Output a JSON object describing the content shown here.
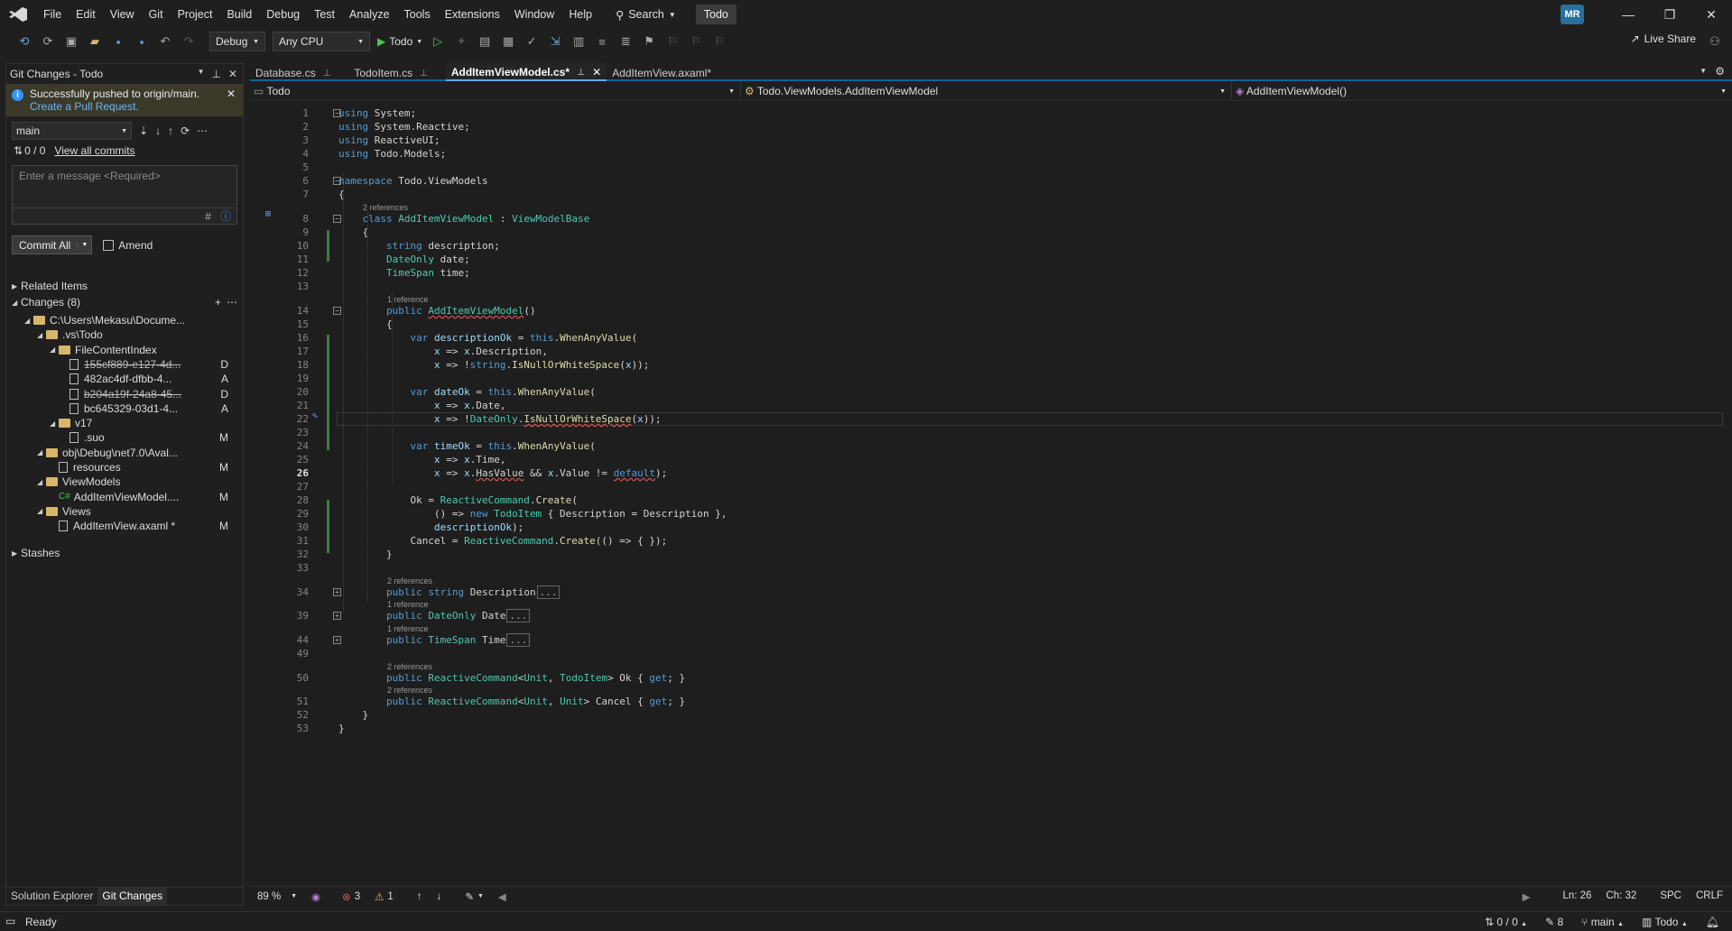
{
  "titlebar": {
    "menu": [
      "File",
      "Edit",
      "View",
      "Git",
      "Project",
      "Build",
      "Debug",
      "Test",
      "Analyze",
      "Tools",
      "Extensions",
      "Window",
      "Help"
    ],
    "search_label": "Search",
    "solution_name": "Todo",
    "user_initials": "MR"
  },
  "toolbar": {
    "config": "Debug",
    "platform": "Any CPU",
    "run_target": "Todo",
    "live_share": "Live Share"
  },
  "git_panel": {
    "title": "Git Changes - Todo",
    "notification": "Successfully pushed to origin/main.",
    "notification_link": "Create a Pull Request.",
    "branch": "main",
    "commit_counts": "0 / 0",
    "view_all_commits": "View all commits",
    "message_placeholder": "Enter a message <Required>",
    "commit_all": "Commit All",
    "amend": "Amend",
    "related_items": "Related Items",
    "changes": "Changes (8)",
    "stashes": "Stashes",
    "tree": [
      {
        "label": "C:\\Users\\Mekasu\\Docume...",
        "status": ""
      },
      {
        "label": ".vs\\Todo",
        "status": ""
      },
      {
        "label": "FileContentIndex",
        "status": ""
      },
      {
        "label": "155cf889-e127-4d...",
        "status": "D"
      },
      {
        "label": "482ac4df-dfbb-4...",
        "status": "A"
      },
      {
        "label": "b204a19f-24a8-45...",
        "status": "D"
      },
      {
        "label": "bc645329-03d1-4...",
        "status": "A"
      },
      {
        "label": "v17",
        "status": ""
      },
      {
        "label": ".suo",
        "status": "M"
      },
      {
        "label": "obj\\Debug\\net7.0\\Aval...",
        "status": ""
      },
      {
        "label": "resources",
        "status": "M"
      },
      {
        "label": "ViewModels",
        "status": ""
      },
      {
        "label": "AddItemViewModel....",
        "status": "M"
      },
      {
        "label": "Views",
        "status": ""
      },
      {
        "label": "AddItemView.axaml *",
        "status": "M"
      }
    ],
    "bottom_tabs": [
      "Solution Explorer",
      "Git Changes"
    ]
  },
  "editor": {
    "tabs": [
      "Database.cs",
      "TodoItem.cs",
      "AddItemViewModel.cs*",
      "AddItemView.axaml*"
    ],
    "nav_project": "Todo",
    "nav_class": "Todo.ViewModels.AddItemViewModel",
    "nav_member": "AddItemViewModel()",
    "refs": {
      "two": "2 references",
      "one": "1 reference"
    },
    "line_numbers": [
      "1",
      "2",
      "3",
      "4",
      "5",
      "6",
      "7",
      "8",
      "9",
      "10",
      "11",
      "12",
      "13",
      "14",
      "15",
      "16",
      "17",
      "18",
      "19",
      "20",
      "21",
      "22",
      "23",
      "24",
      "25",
      "26",
      "27",
      "28",
      "29",
      "30",
      "31",
      "32",
      "33",
      "34",
      "39",
      "44",
      "49",
      "50",
      "51",
      "52",
      "53"
    ],
    "status": {
      "zoom": "89 %",
      "errors": "3",
      "warnings": "1",
      "position": "Ln: 26",
      "column": "Ch: 32",
      "whitespace": "SPC",
      "eol": "CRLF"
    }
  },
  "statusbar": {
    "ready": "Ready",
    "commits": "0 / 0",
    "changes": "8",
    "branch": "main",
    "repo": "Todo"
  }
}
